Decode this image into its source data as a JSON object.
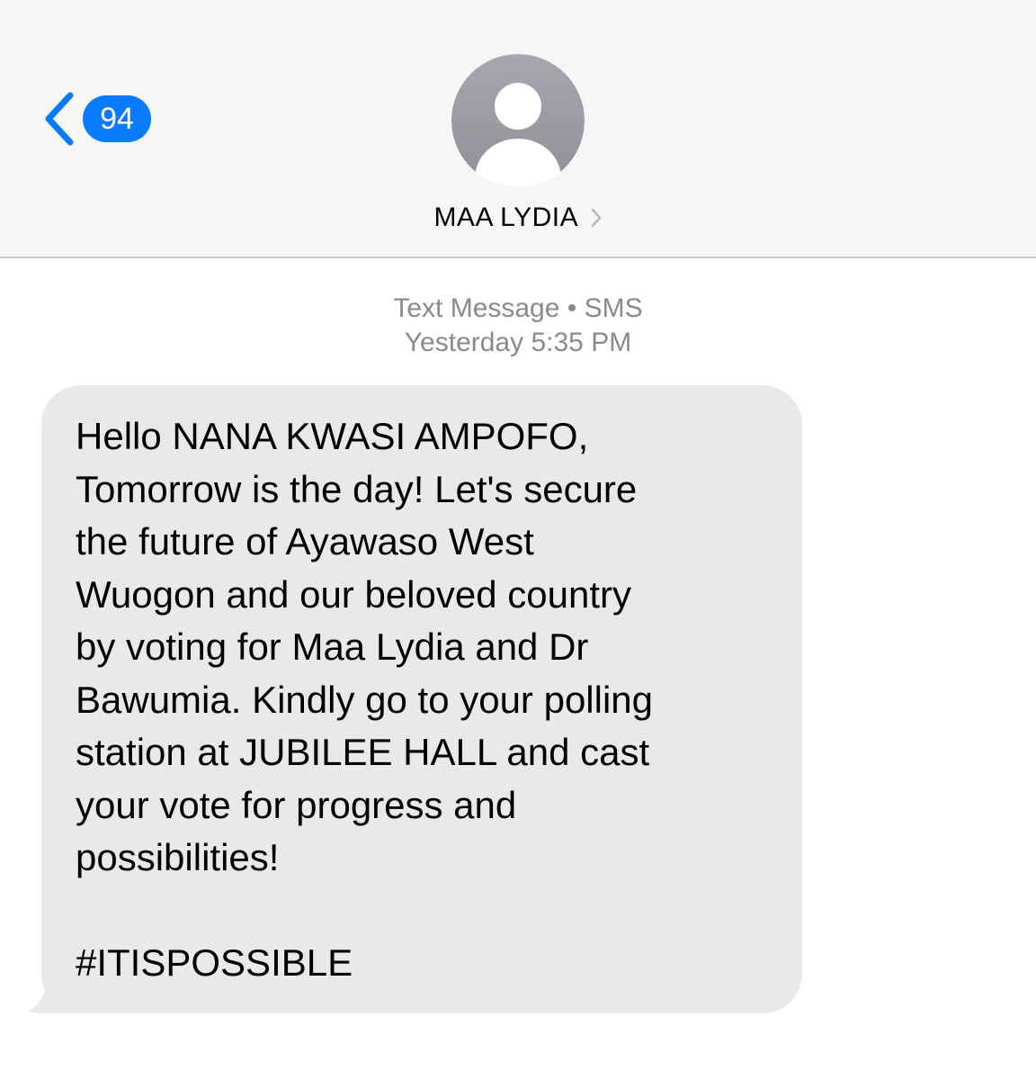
{
  "nav": {
    "unread_count": "94",
    "contact_name": "MAA LYDIA"
  },
  "thread": {
    "service_label": "Text Message",
    "separator": "•",
    "service_type": "SMS",
    "day": "Yesterday",
    "time": "5:35 PM"
  },
  "message": {
    "body": "Hello NANA KWASI AMPOFO,\nTomorrow is the day! Let's secure\nthe future of Ayawaso West\nWuogon and our beloved country\nby voting for Maa Lydia and Dr\nBawumia. Kindly go to your polling\nstation at JUBILEE HALL and cast\nyour vote for progress and\npossibilities!",
    "hashtag": "#ITISPOSSIBLE"
  },
  "colors": {
    "accent_blue": "#0a7aff",
    "header_bg": "#f6f6f6",
    "bubble_bg": "#e9e9eb",
    "meta_text": "#8a8a8e",
    "avatar_bg": "#9b9ca4"
  },
  "icons": {
    "back": "chevron-left-icon",
    "avatar": "person-icon",
    "name_disclosure": "chevron-right-icon"
  }
}
